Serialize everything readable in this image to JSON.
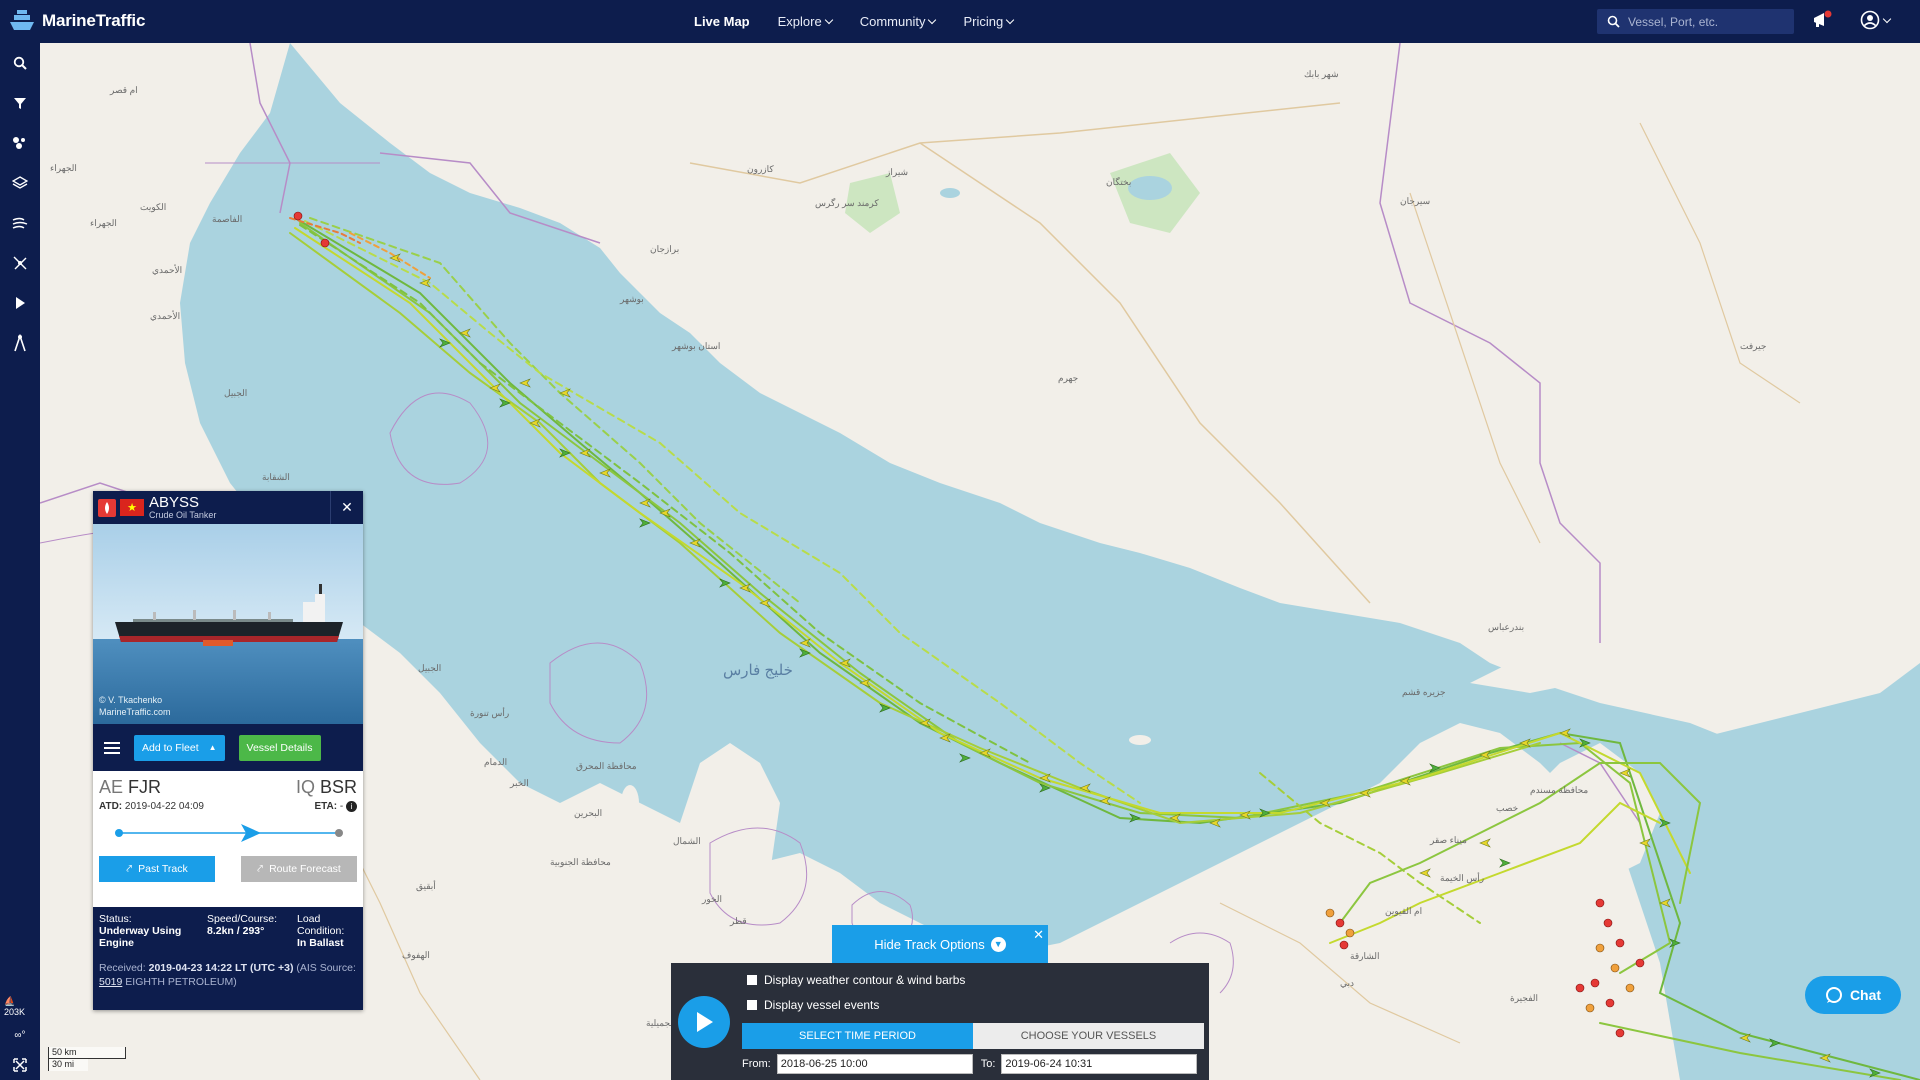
{
  "app": {
    "name": "MarineTraffic"
  },
  "nav": {
    "items": [
      {
        "label": "Live Map",
        "active": true,
        "dropdown": false
      },
      {
        "label": "Explore",
        "dropdown": true
      },
      {
        "label": "Community",
        "dropdown": true
      },
      {
        "label": "Pricing",
        "dropdown": true
      }
    ]
  },
  "search": {
    "placeholder": "Vessel, Port, etc."
  },
  "sidebar": {
    "tools": [
      "search-icon",
      "filter-icon",
      "density-icon",
      "layers-icon",
      "weather-icon",
      "measure-icon",
      "play-icon",
      "route-icon"
    ],
    "vessel_count": "203K",
    "infinity_label": "∞°",
    "fullscreen_icon": "fullscreen-icon"
  },
  "map": {
    "sea_label": "خليج فارس",
    "places": [
      {
        "name": "ام قصر"
      },
      {
        "name": "الجهراء"
      },
      {
        "name": "الكويت"
      },
      {
        "name": "الجهراء"
      },
      {
        "name": "الفاصمة"
      },
      {
        "name": "الأحمدي"
      },
      {
        "name": "الأحمدي"
      },
      {
        "name": "الجبيل"
      },
      {
        "name": "الشقابة"
      },
      {
        "name": "شهر بابك"
      },
      {
        "name": "كازرون"
      },
      {
        "name": "شیراز"
      },
      {
        "name": "بختگان"
      },
      {
        "name": "كرمند سر رگرس"
      },
      {
        "name": "سیرجان"
      },
      {
        "name": "برازجان"
      },
      {
        "name": "بوشهر"
      },
      {
        "name": "استان بوشهر"
      },
      {
        "name": "جهرم"
      },
      {
        "name": "جیرفت"
      },
      {
        "name": "بندرعباس"
      },
      {
        "name": "جزيره قشم"
      },
      {
        "name": "الجبيل"
      },
      {
        "name": "رأس تنورة"
      },
      {
        "name": "الدمام"
      },
      {
        "name": "الخبر"
      },
      {
        "name": "محافظة المحرق"
      },
      {
        "name": "البحرين"
      },
      {
        "name": "محافظة الجنوبية"
      },
      {
        "name": "الشمال"
      },
      {
        "name": "الخور"
      },
      {
        "name": "قطر"
      },
      {
        "name": "الجميلية"
      },
      {
        "name": "الهفوف"
      },
      {
        "name": "أبقيق"
      },
      {
        "name": "ام القيوين"
      },
      {
        "name": "الشارقة"
      },
      {
        "name": "دبي"
      },
      {
        "name": "الفجيرة"
      },
      {
        "name": "رأس الخيمة"
      },
      {
        "name": "خصب"
      },
      {
        "name": "محافظة مسندم"
      },
      {
        "name": "ميناء صقر"
      }
    ]
  },
  "vessel": {
    "name": "ABYSS",
    "type": "Crude Oil Tanker",
    "photo_credit_1": "© V. Tkachenko",
    "photo_credit_2": "MarineTraffic.com",
    "actions": {
      "add_to_fleet": "Add to Fleet",
      "details": "Vessel Details"
    },
    "departure": {
      "country": "AE",
      "port": "FJR",
      "label": "ATD:",
      "time": "2019-04-22 04:09"
    },
    "arrival": {
      "country": "IQ",
      "port": "BSR",
      "label": "ETA:",
      "time": "-"
    },
    "voyage_progress": 0.6,
    "past_track": "Past Track",
    "route_forecast": "Route Forecast",
    "status_label": "Status:",
    "status_value": "Underway Using Engine",
    "speed_label": "Speed/Course:",
    "speed_value": "8.2kn / 293°",
    "load_label": "Load Condition:",
    "load_value": "In Ballast",
    "received_prefix": "Received:",
    "received_value": "2019-04-23 14:22 LT (UTC +3)",
    "received_suffix": "(AIS Source:",
    "source_id": "5019",
    "source_name": "EIGHTH PETROLEUM)"
  },
  "track_options": {
    "hide_label": "Hide Track Options",
    "weather_label": "Display weather contour & wind barbs",
    "events_label": "Display vessel events",
    "tab_time": "SELECT TIME PERIOD",
    "tab_vessels": "CHOOSE YOUR VESSELS",
    "from_label": "From:",
    "from_value": "2018-06-25 10:00",
    "to_label": "To:",
    "to_value": "2019-06-24 10:31"
  },
  "chat": {
    "label": "Chat"
  },
  "scale": {
    "km": "50 km",
    "mi": "30 mi"
  },
  "colors": {
    "navy": "#0d1d4d",
    "accent": "#1a9ee8",
    "green": "#4cb848",
    "water": "#aad3df",
    "land": "#f2efe9"
  }
}
